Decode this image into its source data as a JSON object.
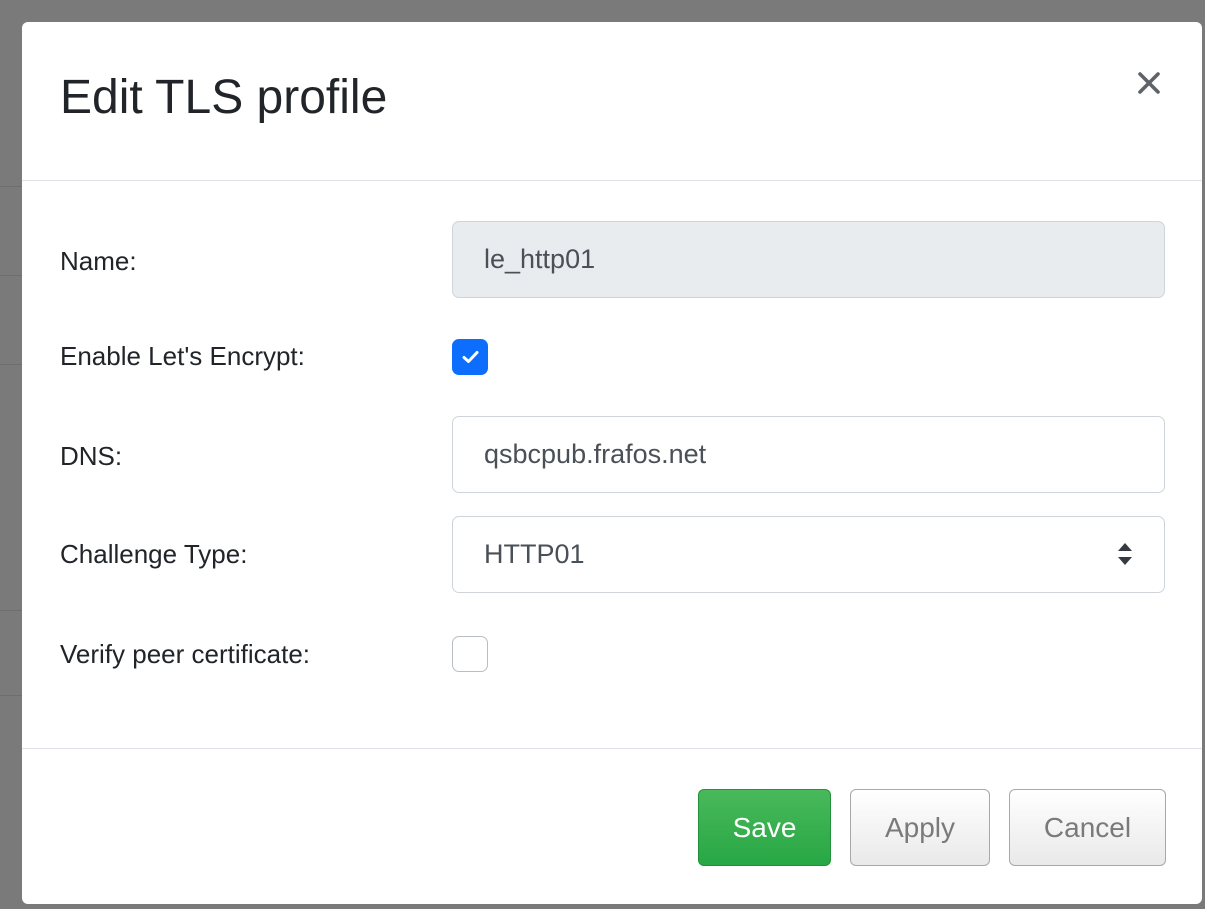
{
  "dialog": {
    "title": "Edit TLS profile",
    "close_icon": "close-icon"
  },
  "form": {
    "name": {
      "label": "Name:",
      "value": "le_http01",
      "readonly": true
    },
    "enable_lets_encrypt": {
      "label": "Enable Let's Encrypt:",
      "checked": true,
      "icon": "checkmark-icon"
    },
    "dns": {
      "label": "DNS:",
      "value": "qsbcpub.frafos.net"
    },
    "challenge_type": {
      "label": "Challenge Type:",
      "selected": "HTTP01",
      "icon": "select-arrows-icon"
    },
    "verify_peer_certificate": {
      "label": "Verify peer certificate:",
      "checked": false
    }
  },
  "footer": {
    "save_label": "Save",
    "apply_label": "Apply",
    "cancel_label": "Cancel"
  },
  "colors": {
    "primary": "#0d6efd",
    "success": "#28a745",
    "readonly_bg": "#e9ecef",
    "backdrop": "#7a7a7a"
  }
}
